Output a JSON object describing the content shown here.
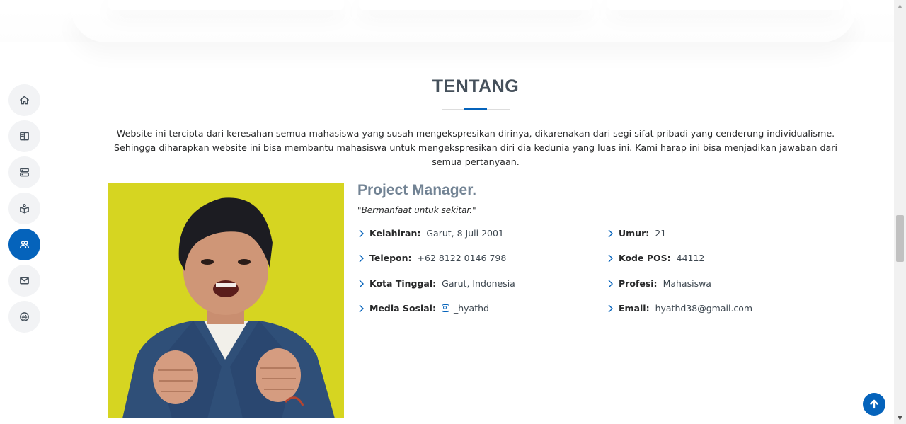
{
  "nav": {
    "items": [
      {
        "icon": "home-icon",
        "active": false
      },
      {
        "icon": "book-icon",
        "active": false
      },
      {
        "icon": "server-icon",
        "active": false
      },
      {
        "icon": "book-open-icon",
        "active": false
      },
      {
        "icon": "users-icon",
        "active": true
      },
      {
        "icon": "envelope-icon",
        "active": false
      },
      {
        "icon": "smiley-icon",
        "active": false
      }
    ]
  },
  "about": {
    "title": "TENTANG",
    "description": "Website ini tercipta dari keresahan semua mahasiswa yang susah mengekspresikan dirinya, dikarenakan dari segi sifat pribadi yang cenderung individualisme. Sehingga diharapkan website ini bisa membantu mahasiswa untuk mengekspresikan diri dia kedunia yang luas ini. Kami harap ini bisa menjadikan jawaban dari semua pertanyaan.",
    "role": "Project Manager.",
    "quote": "\"Bermanfaat untuk sekitar.\"",
    "info_left": [
      {
        "label": "Kelahiran:",
        "value": "Garut, 8 Juli 2001"
      },
      {
        "label": "Telepon:",
        "value": "+62 8122 0146 798"
      },
      {
        "label": "Kota Tinggal:",
        "value": "Garut, Indonesia"
      },
      {
        "label": "Media Sosial:",
        "value": "_hyathd",
        "icon": "instagram-icon"
      }
    ],
    "info_right": [
      {
        "label": "Umur:",
        "value": "21"
      },
      {
        "label": "Kode POS:",
        "value": "44112"
      },
      {
        "label": "Profesi:",
        "value": "Mahasiswa"
      },
      {
        "label": "Email:",
        "value": "hyathd38@gmail.com"
      }
    ]
  },
  "colors": {
    "accent": "#0563bb",
    "title": "#45505b",
    "role": "#728394",
    "photo_background": "#d8d520"
  }
}
